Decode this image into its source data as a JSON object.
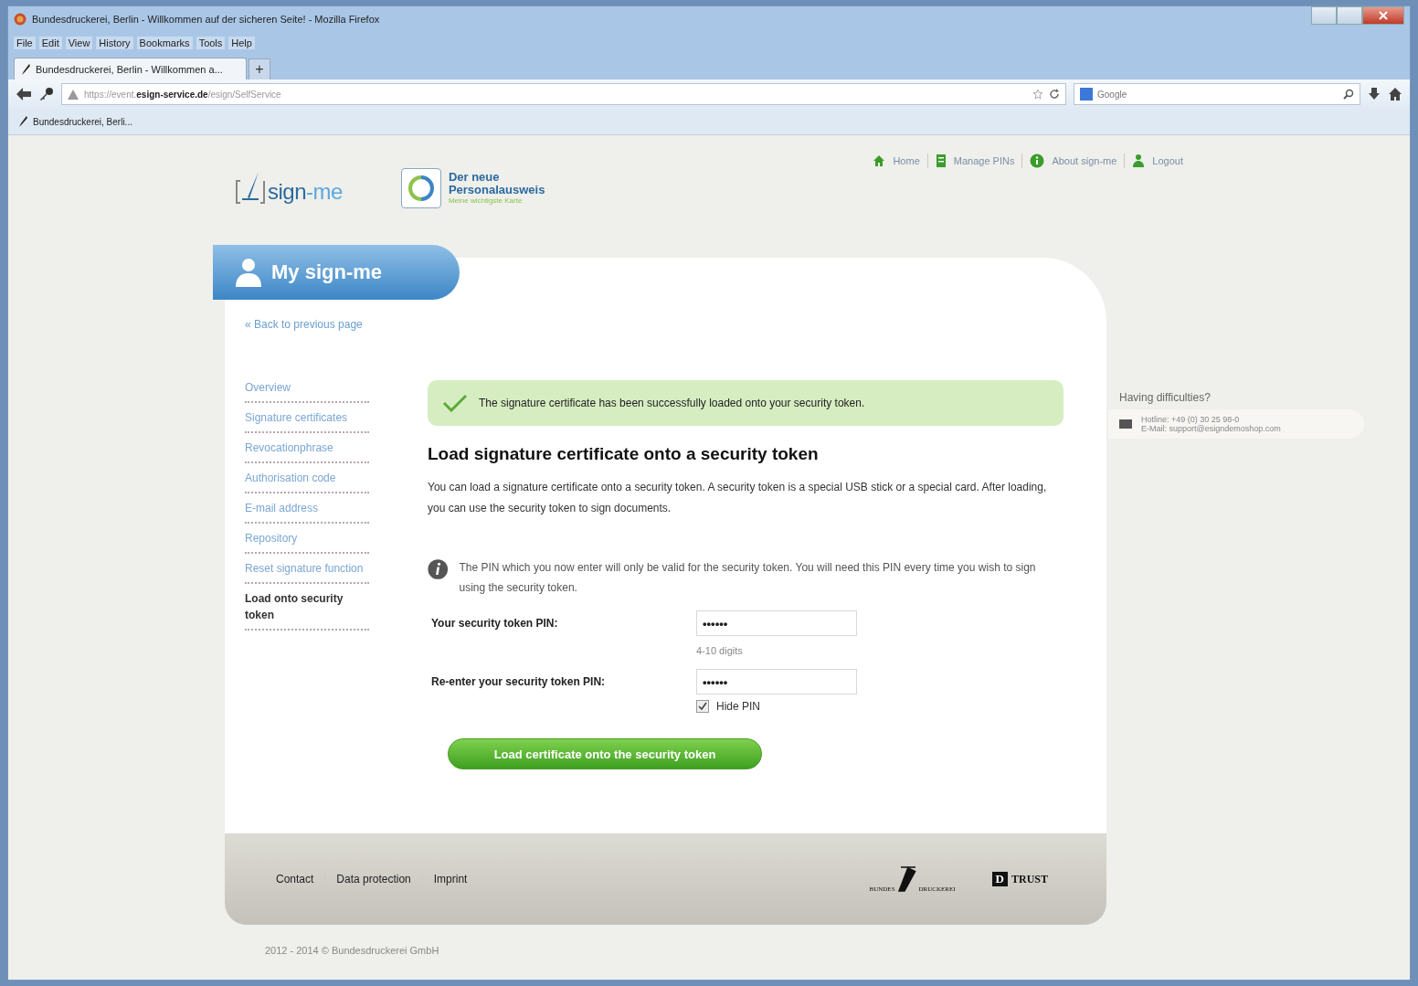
{
  "window": {
    "title": "Bundesdruckerei, Berlin - Willkommen auf der sicheren Seite! - Mozilla Firefox"
  },
  "menu": [
    "File",
    "Edit",
    "View",
    "History",
    "Bookmarks",
    "Tools",
    "Help"
  ],
  "tabs": [
    {
      "label": "Bundesdruckerei, Berlin - Willkommen a...",
      "selected": true
    }
  ],
  "new_tab": "+",
  "address": {
    "prefix": "https://event.",
    "domain": "esign-service.de",
    "path": "/esign/SelfService"
  },
  "search": {
    "placeholder": "Google"
  },
  "bookmarks": [
    "Bundesdruckerei, Berli..."
  ],
  "logo": {
    "part_1": "sign",
    "part_2": "-me"
  },
  "npa_logo": {
    "line_1": "Der neue",
    "line_2": "Personalausweis",
    "tagline": "Meine wichtigste Karte"
  },
  "top_nav": [
    {
      "kind": "home",
      "label": "Home"
    },
    {
      "kind": "pins",
      "label": "Manage PINs"
    },
    {
      "kind": "about",
      "label": "About sign-me"
    },
    {
      "kind": "logout",
      "label": "Logout"
    }
  ],
  "section_tab": "My sign-me",
  "back_link": "« Back to previous page",
  "sidebar": {
    "items": [
      {
        "label": "Overview",
        "selected": false
      },
      {
        "label": "Signature certificates",
        "selected": false
      },
      {
        "label": "Revocationphrase",
        "selected": false
      },
      {
        "label": "Authorisation code",
        "selected": false
      },
      {
        "label": "E-mail address",
        "selected": false
      },
      {
        "label": "Repository",
        "selected": false
      },
      {
        "label": "Reset signature function",
        "selected": false
      },
      {
        "label": "Load onto security token",
        "selected": true
      }
    ]
  },
  "success_message": "The signature certificate has been successfully loaded onto your security token.",
  "heading": "Load signature certificate onto a security token",
  "intro": "You can load a signature certificate onto a security token. A security token is a special USB stick or a special card. After loading, you can use the security token to sign documents.",
  "info": "The PIN which you now enter will only be valid for the security token. You will need this PIN every time you wish to sign using the security token.",
  "form": {
    "pin_label": "Your security token PIN:",
    "pin_value": "••••••",
    "pin_hint": "4-10 digits",
    "repeat_label": "Re-enter your security token PIN:",
    "repeat_value": "••••••",
    "hide_pin": {
      "label": "Hide PIN",
      "checked": true
    }
  },
  "submit_button": "Load certificate onto the security token",
  "help": {
    "title": "Having difficulties?",
    "hotline": "Hotline: +49 (0) 30 25 98-0",
    "email": "E-Mail: support@esigndemoshop.com"
  },
  "footer": {
    "links": [
      "Contact",
      "Data protection",
      "Imprint"
    ],
    "bdr_logo": {
      "part_1": "BUNDES",
      "part_2": "DRUCKEREI"
    },
    "dtrust_logo": {
      "mark": "D",
      "word": "TRUST"
    }
  },
  "copyright": "2012 - 2014 © Bundesdruckerei GmbH"
}
